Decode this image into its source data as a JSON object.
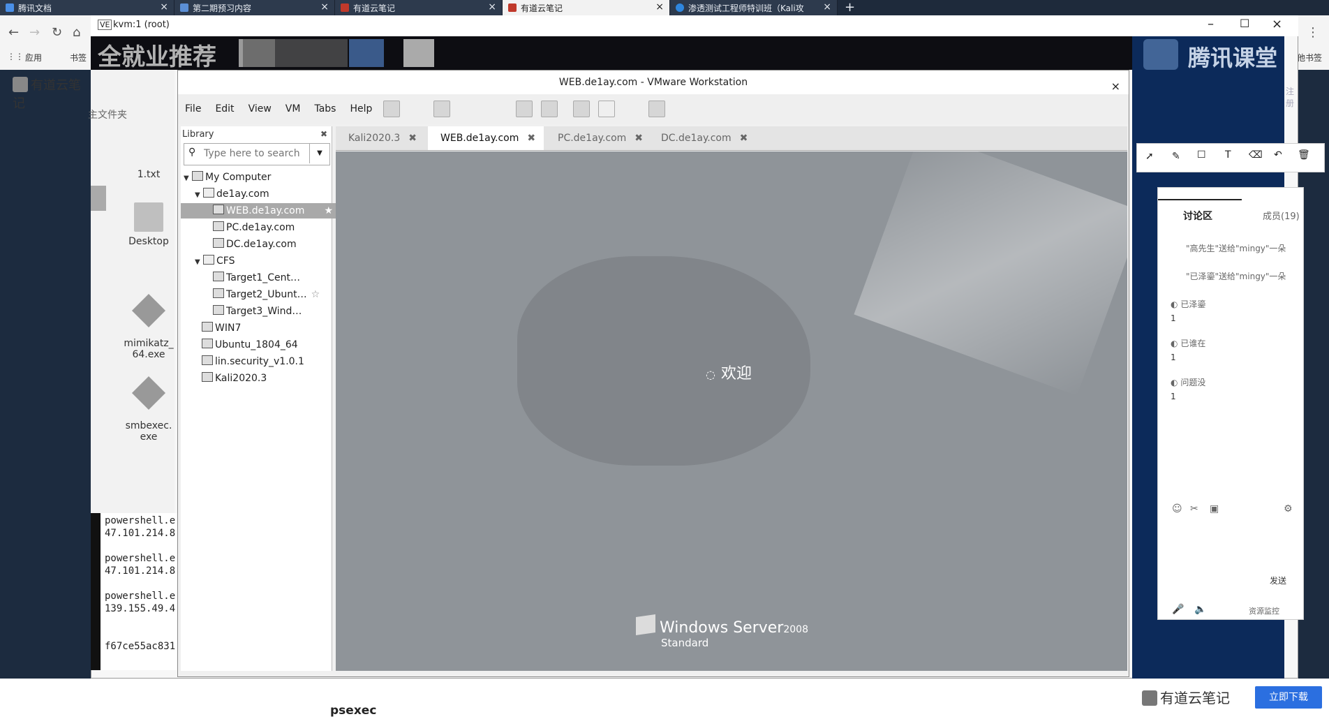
{
  "browser": {
    "tabs": [
      {
        "label": "腾讯文档"
      },
      {
        "label": "第二期预习内容"
      },
      {
        "label": "有道云笔记"
      },
      {
        "label": "有道云笔记"
      },
      {
        "label": "渗透测试工程师特训班（Kali攻"
      }
    ],
    "new_tab": "+",
    "bookmarks": [
      "应用",
      "书签"
    ],
    "bookmarks_right": "其他书签"
  },
  "kvm": {
    "title": "kvm:1 (root)"
  },
  "overlay": {
    "recommend": "全就业推荐",
    "tencent": "腾讯课堂"
  },
  "note_app": {
    "title": "有道云笔记",
    "home_tab": "主文件夹",
    "download": "立即下载",
    "footer": "有道云笔记",
    "register": "注册"
  },
  "desktop": {
    "icons": [
      {
        "label": "1.txt"
      },
      {
        "label": "Desktop"
      },
      {
        "label": "mimikatz_\n64.exe"
      },
      {
        "label": "smbexec.\nexe"
      }
    ]
  },
  "terminal": {
    "lines": [
      "powershell.e",
      "47.101.214.8",
      "",
      "powershell.e",
      "47.101.214.8",
      "",
      "powershell.e",
      "139.155.49.4",
      "",
      "",
      "f67ce55ac831"
    ]
  },
  "vmware": {
    "title": "WEB.de1ay.com - VMware Workstation",
    "menu": [
      "File",
      "Edit",
      "View",
      "VM",
      "Tabs",
      "Help"
    ],
    "library": {
      "header": "Library",
      "search_placeholder": "Type here to search",
      "tree": [
        {
          "label": "My Computer"
        },
        {
          "label": "de1ay.com"
        },
        {
          "label": "WEB.de1ay.com"
        },
        {
          "label": "PC.de1ay.com"
        },
        {
          "label": "DC.de1ay.com"
        },
        {
          "label": "CFS"
        },
        {
          "label": "Target1_Cent…"
        },
        {
          "label": "Target2_Ubunt…"
        },
        {
          "label": "Target3_Wind…"
        },
        {
          "label": "WIN7"
        },
        {
          "label": "Ubuntu_1804_64"
        },
        {
          "label": "lin.security_v1.0.1"
        },
        {
          "label": "Kali2020.3"
        }
      ]
    },
    "tabs": [
      {
        "label": "Kali2020.3"
      },
      {
        "label": "WEB.de1ay.com"
      },
      {
        "label": "PC.de1ay.com"
      },
      {
        "label": "DC.de1ay.com"
      }
    ],
    "console": {
      "welcome": "欢迎",
      "os_name": "Windows Server",
      "os_version": "2008",
      "edition": "Standard"
    }
  },
  "chat": {
    "tab_discuss": "讨论区",
    "tab_members": "成员(19)",
    "messages": [
      "\"高先生\"送给\"mingy\"一朵",
      "\"已泽鎏\"送给\"mingy\"一朵"
    ],
    "users": [
      {
        "name": "已泽鎏",
        "msg": "1"
      },
      {
        "name": "已谁在",
        "msg": "1"
      },
      {
        "name": "问题没",
        "msg": "1"
      }
    ],
    "send": "发送",
    "resource": "资源监控"
  },
  "caption": "psexec"
}
